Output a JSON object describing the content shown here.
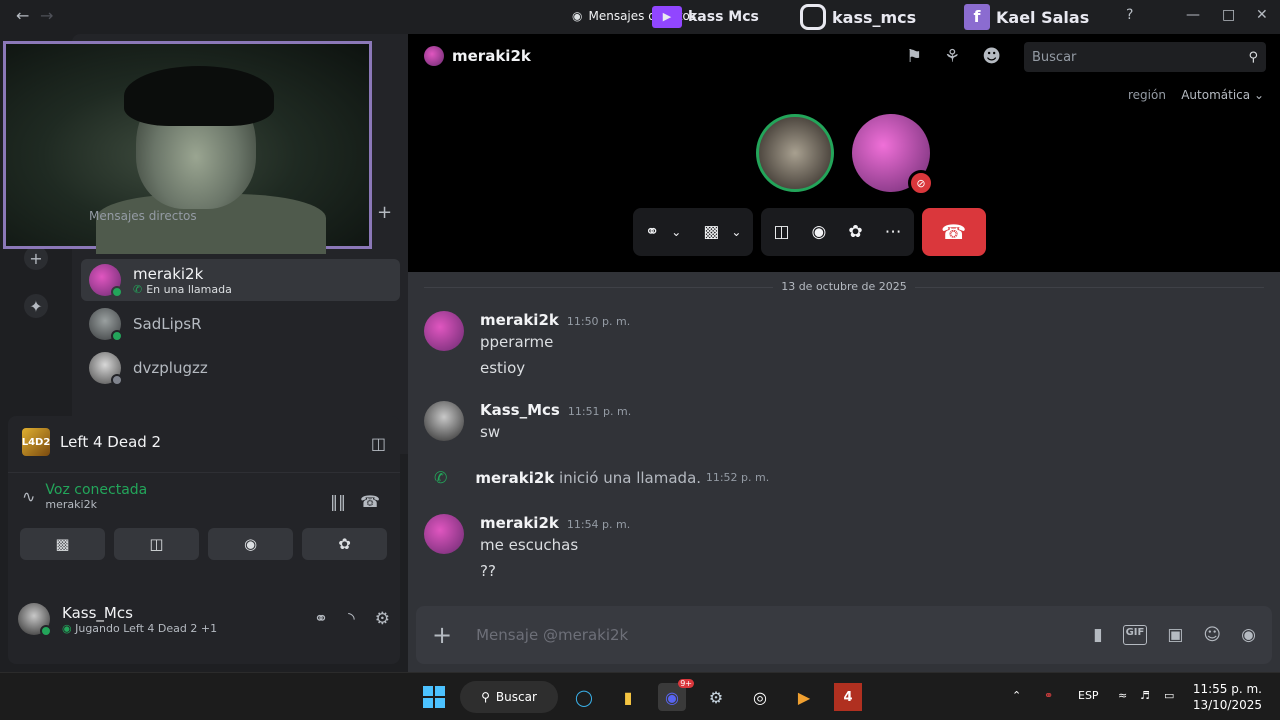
{
  "titlebar": {
    "title": "Mensajes directos",
    "overlay": {
      "twitch": "kass Mcs",
      "instagram": "kass_mcs",
      "facebook": "Kael Salas"
    }
  },
  "dm": {
    "header": "Mensajes directos",
    "items": [
      {
        "name": "meraki2k",
        "sub": "En una llamada",
        "active": true
      },
      {
        "name": "SadLipsR"
      },
      {
        "name": "dvzplugzz"
      }
    ]
  },
  "activity": {
    "game_icon_text": "L4D2",
    "game": "Left 4 Dead 2",
    "voice_status": "Voz conectada",
    "voice_channel": "meraki2k"
  },
  "user": {
    "name": "Kass_Mcs",
    "activity": "Jugando Left 4 Dead 2 +1"
  },
  "call": {
    "title": "meraki2k",
    "search_placeholder": "Buscar",
    "region_label": "región",
    "region_value": "Automática"
  },
  "chat": {
    "date": "13 de octubre de 2025",
    "messages": [
      {
        "author": "meraki2k",
        "time": "11:50 p. m.",
        "lines": [
          "pperarme",
          "estioy"
        ]
      },
      {
        "author": "Kass_Mcs",
        "time": "11:51 p. m.",
        "lines": [
          "sw"
        ]
      },
      {
        "author": "meraki2k",
        "time": "11:54 p. m.",
        "lines": [
          "me escuchas",
          "??"
        ]
      }
    ],
    "call_event": {
      "author": "meraki2k",
      "text": "inició una llamada.",
      "time": "11:52 p. m."
    },
    "composer_placeholder": "Mensaje @meraki2k",
    "gif_label": "GIF"
  },
  "taskbar": {
    "search": "Buscar",
    "lang": "ESP",
    "discord_badge": "9+",
    "time": "11:55 p. m.",
    "date": "13/10/2025"
  },
  "colors": {
    "green": "#23a55a",
    "red": "#da373c",
    "accent": "#5865f2"
  }
}
